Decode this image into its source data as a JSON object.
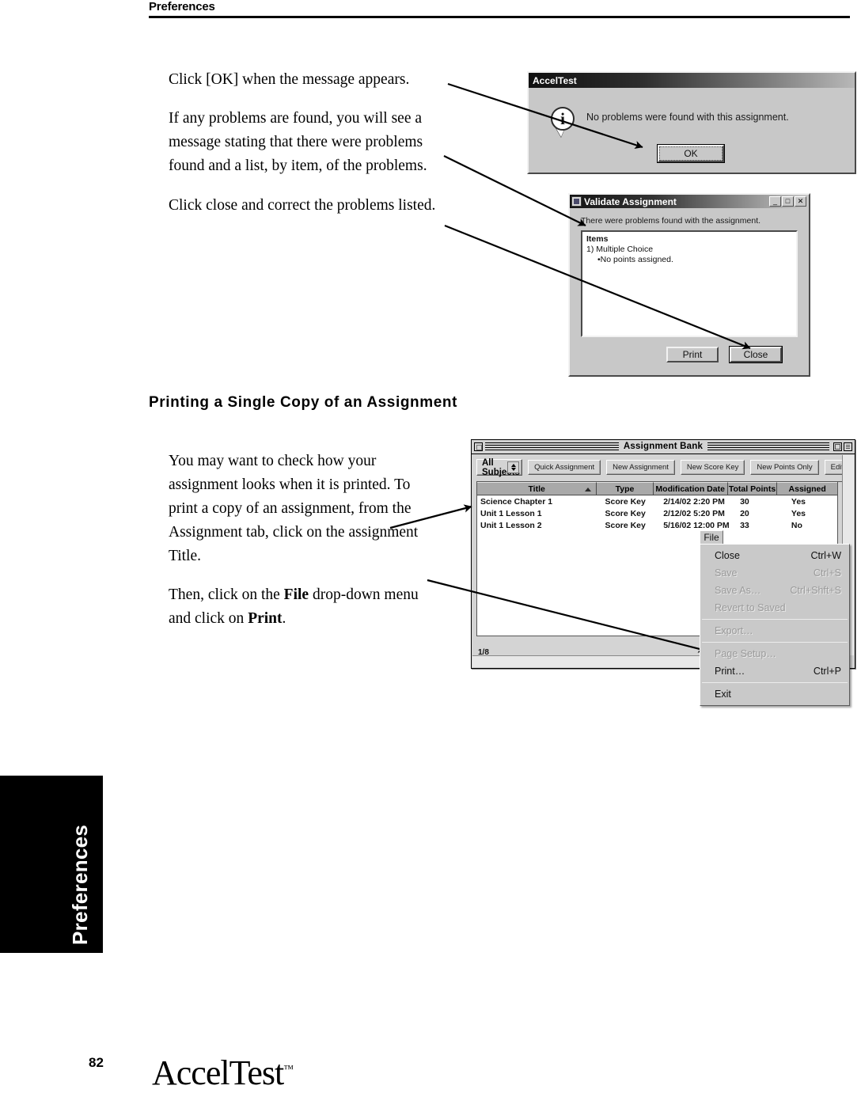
{
  "page": {
    "running_head": "Preferences",
    "page_number": "82",
    "side_tab_label": "Preferences",
    "brand": "AccelTest",
    "brand_tm": "™"
  },
  "body": {
    "paragraphs_top": [
      "Click [OK] when the message appears.",
      "If any problems are found, you will see a message stating that there were problems found and a list, by item, of the problems.",
      "Click close and correct the problems listed."
    ],
    "section_heading": "Printing a Single Copy of an Assignment",
    "paragraph_print_1": "You may want to check how your assignment looks when it is printed. To print a copy of an assignment, from the Assignment tab, click on the assignment Title.",
    "paragraph_print_2_a": "Then, click on the ",
    "paragraph_print_2_b": "File",
    "paragraph_print_2_c": " drop-down menu and click on ",
    "paragraph_print_2_d": "Print",
    "paragraph_print_2_e": "."
  },
  "acceltest_dialog": {
    "title": "AccelTest",
    "icon": "info-icon",
    "message": "No problems were found with this assignment.",
    "ok_label": "OK"
  },
  "validate_dialog": {
    "title": "Validate Assignment",
    "message": "There were problems found with the assignment.",
    "minimize_label": "_",
    "maximize_label": "□",
    "close_label": "✕",
    "list": [
      "Items",
      "1) Multiple Choice",
      "•No points assigned."
    ],
    "print_label": "Print",
    "close_button_label": "Close"
  },
  "assignment_bank": {
    "title": "Assignment Bank",
    "subject_filter": "All Subjects",
    "buttons": [
      "Quick Assignment",
      "New Assignment",
      "New Score Key",
      "New Points Only",
      "Edit"
    ],
    "columns": [
      "Title",
      "Type",
      "Modification Date",
      "Total Points",
      "Assigned"
    ],
    "sorted_column": "Title",
    "rows": [
      {
        "title": "Science Chapter 1",
        "type": "Score Key",
        "modified": "2/14/02 2:20 PM",
        "points": "30",
        "assigned": "Yes"
      },
      {
        "title": "Unit 1 Lesson 1",
        "type": "Score Key",
        "modified": "2/12/02 5:20 PM",
        "points": "20",
        "assigned": "Yes"
      },
      {
        "title": "Unit 1 Lesson 2",
        "type": "Score Key",
        "modified": "5/16/02 12:00 PM",
        "points": "33",
        "assigned": "No"
      }
    ],
    "status": "1/8"
  },
  "file_menu": {
    "title": "File",
    "items": [
      {
        "label": "Close",
        "accel": "Ctrl+W",
        "disabled": false
      },
      {
        "label": "Save",
        "accel": "Ctrl+S",
        "disabled": true
      },
      {
        "label": "Save As…",
        "accel": "Ctrl+Shft+S",
        "disabled": true
      },
      {
        "label": "Revert to Saved",
        "accel": "",
        "disabled": true
      },
      {
        "label": "Export…",
        "accel": "",
        "disabled": true
      },
      {
        "label": "Page Setup…",
        "accel": "",
        "disabled": true
      },
      {
        "label": "Print…",
        "accel": "Ctrl+P",
        "disabled": false
      },
      {
        "label": "Exit",
        "accel": "",
        "disabled": false
      }
    ]
  },
  "colors": {
    "ink": "#000000",
    "dialog_face": "#c8c8c8",
    "mac_face": "#d4d4d4",
    "menu_disabled": "#9a9a9a"
  }
}
